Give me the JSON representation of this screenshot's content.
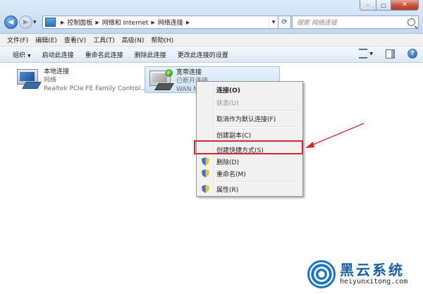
{
  "window": {
    "caption_buttons": {
      "minimize": "–",
      "maximize": "□",
      "close": "✕"
    }
  },
  "address": {
    "breadcrumbs": [
      "控制面板",
      "网络和 Internet",
      "网络连接"
    ],
    "search_placeholder": "搜索 网络连接"
  },
  "menubar": [
    "文件(F)",
    "编辑(E)",
    "查看(V)",
    "工具(T)",
    "高级(N)",
    "帮助(H)"
  ],
  "commandbar": {
    "organize": "组织",
    "items": [
      "启动此连接",
      "重命名此连接",
      "删除此连接",
      "更改此连接的设置"
    ]
  },
  "adapters": [
    {
      "name": "本地连接",
      "status": "网络",
      "device": "Realtek PCIe FE Family Control..."
    },
    {
      "name": "宽带连接",
      "status": "已断开连接",
      "device": "WAN M"
    }
  ],
  "context_menu": {
    "items": [
      {
        "label": "连接(O)",
        "bold": true
      },
      {
        "label": "状态(U)",
        "disabled": true
      },
      {
        "label": "取消作为默认连接(F)"
      },
      {
        "label": "创建副本(C)"
      },
      {
        "label": "创建快捷方式(S)",
        "highlighted": true
      },
      {
        "label": "删除(D)",
        "icon": "uac-shield-icon"
      },
      {
        "label": "重命名(M)",
        "icon": "uac-shield-icon"
      },
      {
        "label": "属性(R)",
        "icon": "uac-shield-icon"
      }
    ],
    "annotation_color": "#d8262c"
  },
  "watermark": {
    "brand": "黑云系统",
    "url": "heiyunxitong.com",
    "color": "#1b74c6"
  }
}
